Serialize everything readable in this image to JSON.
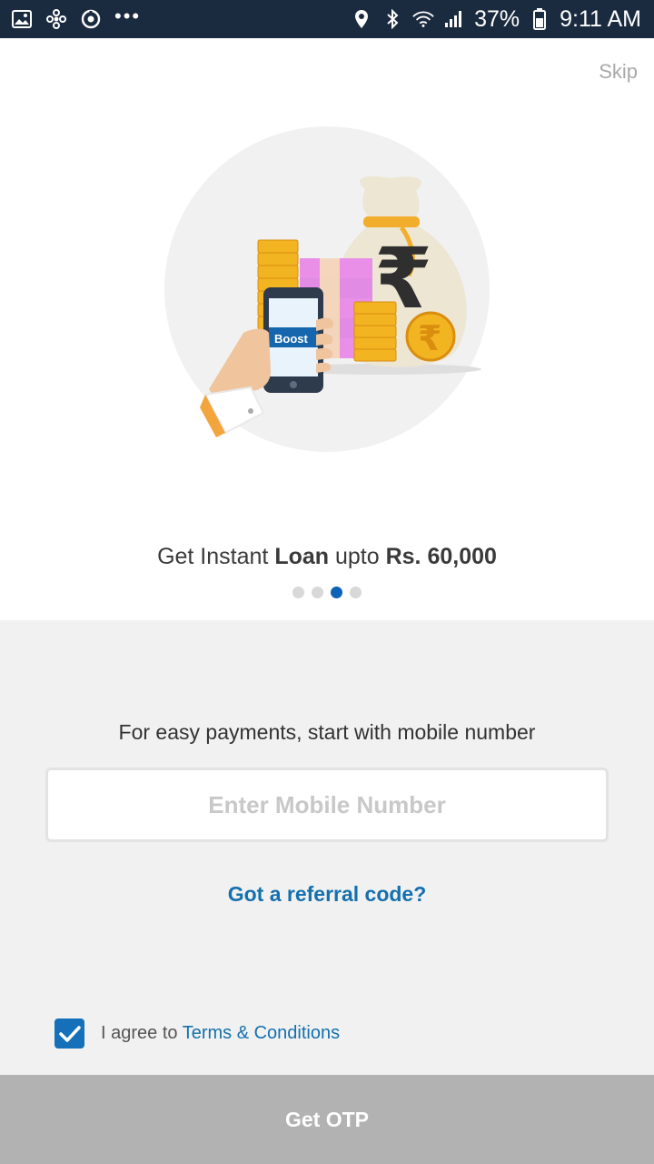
{
  "status_bar": {
    "left_icons": [
      "gallery-icon",
      "fan-icon",
      "sync-icon",
      "more-dots-icon"
    ],
    "more": "•••",
    "right_icons": [
      "location-icon",
      "bluetooth-icon",
      "wifi-icon",
      "signal-icon",
      "battery-icon"
    ],
    "battery": "37%",
    "time": "9:11 AM"
  },
  "onboarding": {
    "skip_label": "Skip",
    "illustration": {
      "phone_label": "Boost",
      "rupee_symbol": "₹"
    },
    "title_prefix": "Get Instant ",
    "title_bold_1": "Loan",
    "title_middle": " upto ",
    "title_bold_2": "Rs. 60,000",
    "dots": {
      "count": 4,
      "active_index": 2
    }
  },
  "login": {
    "prompt": "For easy payments, start with mobile number",
    "mobile_placeholder": "Enter Mobile Number",
    "mobile_value": "",
    "referral_label": "Got a referral code?",
    "agree_checked": true,
    "agree_prefix": "I agree to ",
    "terms_label": "Terms & Conditions",
    "otp_button": "Get OTP"
  },
  "colors": {
    "status_bar": "#1b2b3f",
    "accent_blue": "#1470ae",
    "button_disabled": "#b2b2b2",
    "bottom_bg": "#f1f1f1"
  }
}
